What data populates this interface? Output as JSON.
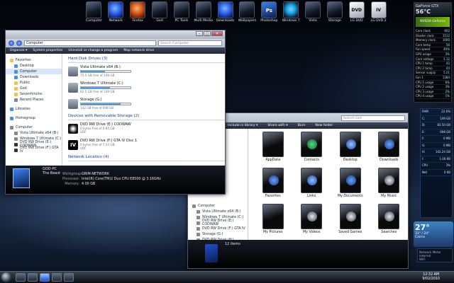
{
  "dock": {
    "items": [
      {
        "label": "Computer",
        "icon": "computer-icon",
        "style": ""
      },
      {
        "label": "Network",
        "icon": "network-globe-icon",
        "style": "blue"
      },
      {
        "label": "Firefox",
        "icon": "firefox-icon",
        "style": "orange"
      },
      {
        "label": "God",
        "icon": "god-folder-icon",
        "style": ""
      },
      {
        "label": "PC Tools",
        "icon": "tools-icon",
        "style": ""
      },
      {
        "label": "Multi Media",
        "icon": "multimedia-icon",
        "style": ""
      },
      {
        "label": "Downloads",
        "icon": "downloads-icon",
        "style": "blue"
      },
      {
        "label": "Wallpapers",
        "icon": "wallpapers-icon",
        "style": ""
      },
      {
        "label": "Photoshop",
        "icon": "photoshop-icon",
        "style": "ps",
        "text": "Ps"
      },
      {
        "label": "Windows 7",
        "icon": "windows-logo-icon",
        "style": "win"
      },
      {
        "label": "Vista",
        "icon": "drive-icon",
        "style": ""
      },
      {
        "label": "Storage",
        "icon": "drive-icon",
        "style": ""
      },
      {
        "label": "LG DVD",
        "icon": "dvd-drive-icon",
        "style": "lg",
        "text": "DVD"
      },
      {
        "label": "LG DVD 2",
        "icon": "dvd-drive-icon",
        "style": "lg",
        "text": "IV"
      }
    ]
  },
  "gpu_gadget": {
    "title": "GeForce GTX",
    "temp": "56°C",
    "brand": "NVIDIA GeForce",
    "rows": [
      {
        "k": "Core clock",
        "v": "602"
      },
      {
        "k": "Shader clock",
        "v": "1512"
      },
      {
        "k": "Memory clock",
        "v": "1000"
      },
      {
        "k": "Core temp",
        "v": "56"
      },
      {
        "k": "Fan speed",
        "v": "40%"
      },
      {
        "k": "GPU usage",
        "v": "3%"
      },
      {
        "k": "Core voltage",
        "v": "1.12"
      },
      {
        "k": "CPU 1 temp",
        "v": "42"
      },
      {
        "k": "CPU 2 temp",
        "v": "44"
      },
      {
        "k": "Sensor supply",
        "v": "5.21"
      },
      {
        "k": "Fan 1",
        "v": "1384"
      },
      {
        "k": "CPU 1 usage",
        "v": "6%"
      },
      {
        "k": "CPU 2 usage",
        "v": "3%"
      },
      {
        "k": "CPU 3 usage",
        "v": "2%"
      },
      {
        "k": "CPU 4 usage",
        "v": "1%"
      }
    ]
  },
  "hdd_gadget": {
    "rows": [
      {
        "k": "RAM",
        "v": "22.6%"
      },
      {
        "k": "C:",
        "v": "149 GB"
      },
      {
        "k": "D:",
        "v": "82.50 GB"
      },
      {
        "k": "E:",
        "v": "698 GB"
      },
      {
        "k": "F:",
        "v": "0 MB"
      },
      {
        "k": "G:",
        "v": "0 MB"
      },
      {
        "k": "H:",
        "v": "142.24 GB"
      },
      {
        "k": "I:",
        "v": "1.00 KB"
      },
      {
        "k": "CPU",
        "v": "3%"
      },
      {
        "k": "Net",
        "v": "0 KB"
      }
    ]
  },
  "weather": {
    "temp": "27°",
    "range": "31° / 24°",
    "city": "Cairns"
  },
  "netmon": {
    "title": "Network Meter",
    "line1": "Internal",
    "line2": "WiFi"
  },
  "explorer": {
    "address": "Computer",
    "search_placeholder": "Search Computer",
    "toolbar": [
      "Organize ▾",
      "System properties",
      "Uninstall or change a program",
      "Map network drive"
    ],
    "nav": [
      {
        "label": "Favorites",
        "cls": "",
        "ico": ""
      },
      {
        "label": "Desktop",
        "cls": "sub",
        "ico": "b"
      },
      {
        "label": "Computer",
        "cls": "sub sel",
        "ico": "b"
      },
      {
        "label": "Downloads",
        "cls": "sub",
        "ico": "b"
      },
      {
        "label": "Public",
        "cls": "sub",
        "ico": ""
      },
      {
        "label": "God",
        "cls": "sub",
        "ico": ""
      },
      {
        "label": "Sevenforums",
        "cls": "sub",
        "ico": ""
      },
      {
        "label": "Recent Places",
        "cls": "sub",
        "ico": "g"
      },
      {
        "label": "",
        "cls": "gap",
        "ico": ""
      },
      {
        "label": "Libraries",
        "cls": "",
        "ico": "b"
      },
      {
        "label": "",
        "cls": "gap",
        "ico": ""
      },
      {
        "label": "Homegroup",
        "cls": "",
        "ico": "b"
      },
      {
        "label": "",
        "cls": "gap",
        "ico": ""
      },
      {
        "label": "Computer",
        "cls": "",
        "ico": "g"
      },
      {
        "label": "Vista Ultimate x64 (B:)",
        "cls": "sub",
        "ico": "g"
      },
      {
        "label": "Windows 7 Ultimate (C:)",
        "cls": "sub",
        "ico": "g"
      },
      {
        "label": "DVD RW Drive (E:) CODWAW",
        "cls": "sub",
        "ico": "d"
      },
      {
        "label": "DVD RW Drive (F:) GTA IV",
        "cls": "sub",
        "ico": "d"
      }
    ],
    "hdd_header": "Hard Disk Drives (3)",
    "drives": [
      {
        "name": "Vista Ultimate x64 (B:)",
        "free": "75.5 GB free of 149 GB",
        "pct": 0.49
      },
      {
        "name": "Windows 7 Ultimate (C:)",
        "free": "62.5 GB free of 149 GB",
        "pct": 0.58
      },
      {
        "name": "Storage (G:)",
        "free": "142 GB free of 698 GB",
        "pct": 0.8
      }
    ],
    "removable_header": "Devices with Removable Storage (2)",
    "removable": [
      {
        "name": "DVD RW Drive (E:) CODWAW",
        "free": "0 bytes free of 6.85 GB",
        "fs": "UDF",
        "icon": "star",
        "glyph": ""
      },
      {
        "name": "DVD RW Drive (F:) GTA IV Disc 1",
        "free": "0 bytes free of 7.03 GB",
        "fs": "UDF",
        "icon": "gta",
        "glyph": "IV"
      }
    ],
    "netloc_header": "Network Location (4)",
    "details": {
      "pc_name": "GOD-PC",
      "pc_desc": "The Beast",
      "workgroup_k": "Workgroup:",
      "workgroup_v": "GRIM-NETWORK",
      "processor_k": "Processor:",
      "processor_v": "Intel(R) Core(TM)2 Duo CPU     E8500  @ 3.16GHz",
      "memory_k": "Memory:",
      "memory_v": "4.00 GB"
    }
  },
  "library": {
    "search_placeholder": "Search Get",
    "toolbar": [
      "Include in library ▾",
      "Share with ▾",
      "Burn",
      "New folder"
    ],
    "nav": [
      "Computer",
      "Vista Ultimate x64 (B:)",
      "Windows 7 Ultimate (C:)",
      "DVD RW Drive (E:) CODWAW",
      "DVD RW Drive (F:) GTA IV",
      "Storage (G:)",
      "DVD RW Drive (H:) ...",
      "DVD RW Drive (I:) ..."
    ],
    "tiles": [
      {
        "label": "AppData",
        "c": ""
      },
      {
        "label": "Contacts",
        "c": "c2"
      },
      {
        "label": "Desktop",
        "c": "c3"
      },
      {
        "label": "Downloads",
        "c": "c1"
      },
      {
        "label": "Favorites",
        "c": "c1"
      },
      {
        "label": "Links",
        "c": "c3"
      },
      {
        "label": "My Documents",
        "c": "c1"
      },
      {
        "label": "My Music",
        "c": "c4"
      },
      {
        "label": "My Pictures",
        "c": ""
      },
      {
        "label": "My Videos",
        "c": "c4"
      },
      {
        "label": "Saved Games",
        "c": "c4"
      },
      {
        "label": "Searches",
        "c": "c4"
      }
    ],
    "status": "12 items"
  },
  "clock": {
    "time": "12:32 AM",
    "date": "9/02/2010"
  }
}
